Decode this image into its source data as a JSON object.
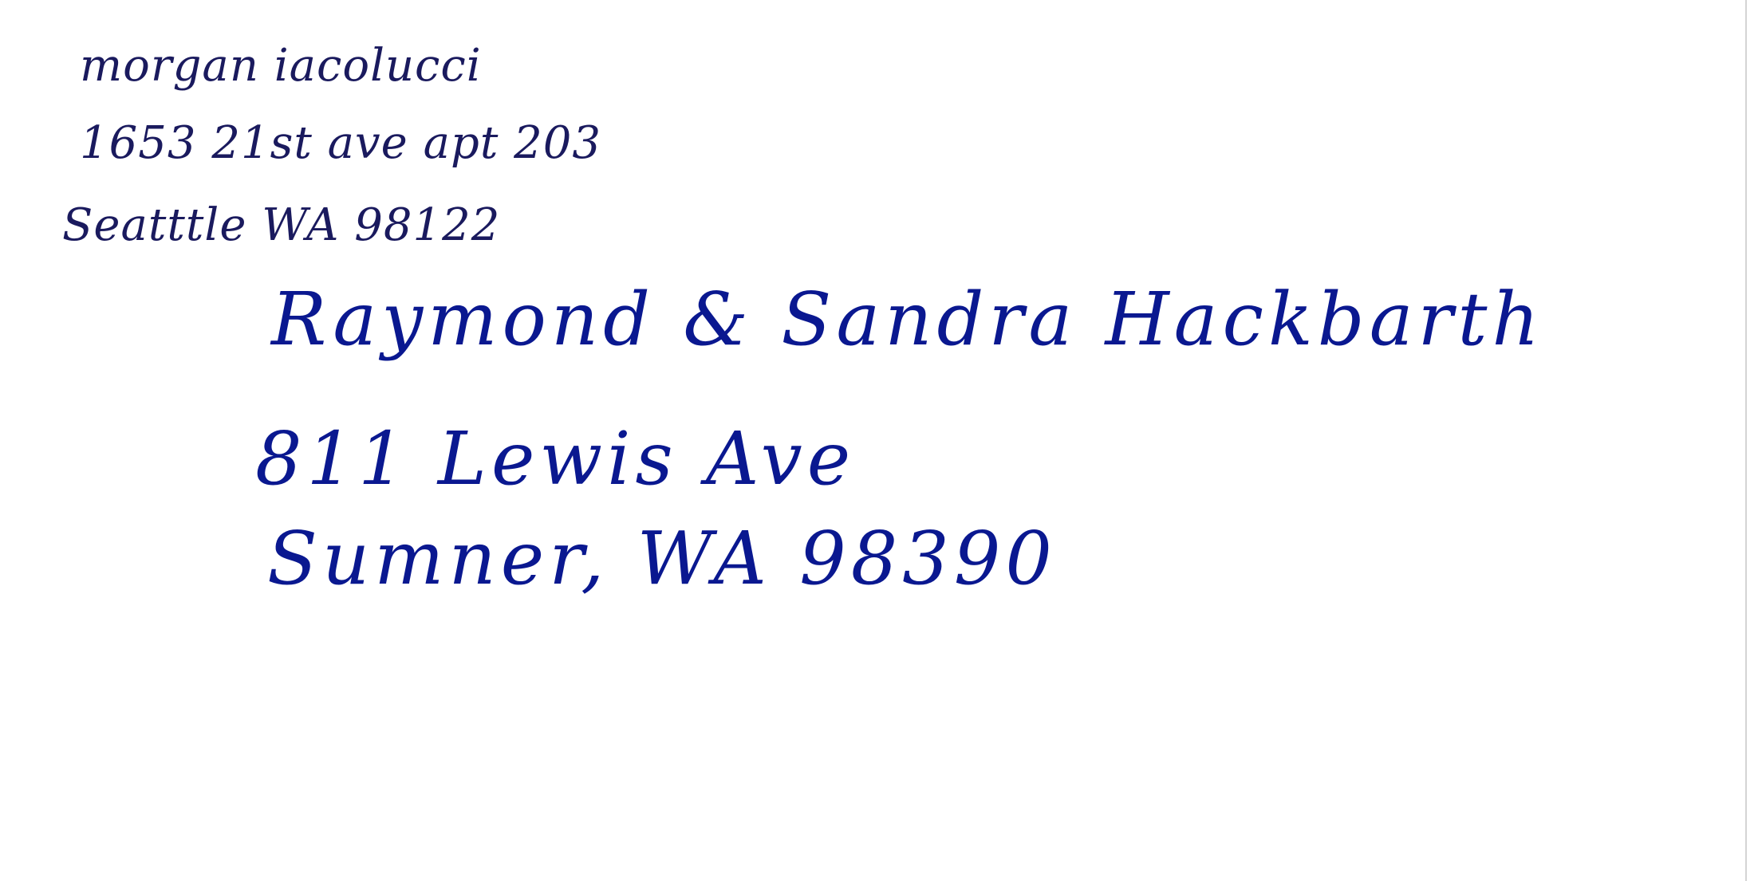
{
  "return_address": {
    "name": "morgan iacolucci",
    "street": "1653 21st ave apt 203",
    "city_line": "Seatttle WA 98122"
  },
  "recipient_address": {
    "name": "Raymond & Sandra Hackbarth",
    "street": "811 Lewis Ave",
    "city_line": "Sumner, WA 98390"
  },
  "colors": {
    "return_ink": "#1a1a5e",
    "recipient_ink": "#0a1890",
    "background": "#ffffff"
  }
}
